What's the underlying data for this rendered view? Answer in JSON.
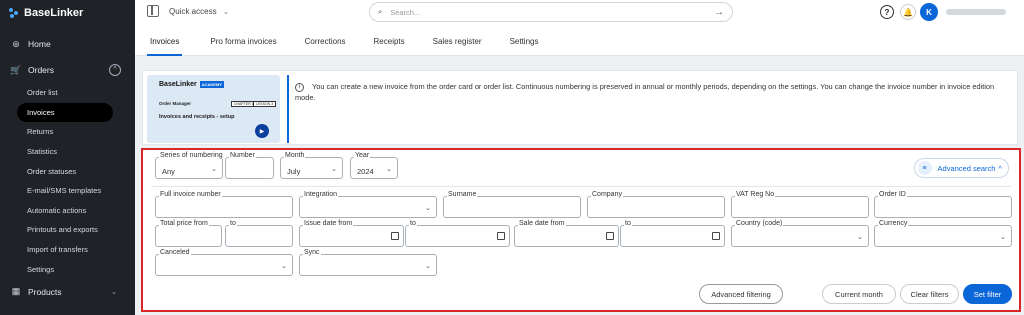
{
  "app": {
    "name": "BaseLinker"
  },
  "sidebar": {
    "home": "Home",
    "orders": "Orders",
    "order_items": [
      "Order list",
      "Invoices",
      "Returns",
      "Statistics",
      "Order statuses",
      "E-mail/SMS templates",
      "Automatic actions",
      "Printouts and exports",
      "Import of transfers",
      "Settings"
    ],
    "products": "Products"
  },
  "topbar": {
    "quick_access": "Quick access",
    "search_placeholder": "Search...",
    "avatar_letter": "K"
  },
  "tabs": [
    "Invoices",
    "Pro forma invoices",
    "Corrections",
    "Receipts",
    "Sales register",
    "Settings"
  ],
  "banner": {
    "thumb_brand": "BaseLinker",
    "thumb_badge": "ACADEMY",
    "thumb_subtitle": "Order Manager",
    "thumb_title": "Invoices and receipts - setup",
    "thumb_chapter": "CHAPTER 1",
    "thumb_lesson": "LESSON 3",
    "info": "You can create a new invoice from the order card or order list. Continuous numbering is preserved in annual or monthly periods, depending on the settings. You can change the invoice number in invoice edition mode."
  },
  "filters": {
    "series_label": "Series of numbering",
    "series_value": "Any",
    "number_label": "Number",
    "month_label": "Month",
    "month_value": "July",
    "year_label": "Year",
    "year_value": "2024",
    "advanced_search": "Advanced search",
    "full_invoice_number": "Full invoice number",
    "integration": "Integration",
    "surname": "Surname",
    "company": "Company",
    "vat": "VAT Reg No",
    "order_id": "Order ID",
    "total_from": "Total price from",
    "to": "to",
    "issue_from": "Issue date from",
    "sale_from": "Sale date from",
    "country": "Country (code)",
    "currency": "Currency",
    "canceled": "Canceled",
    "sync": "Sync",
    "btn_advanced_filtering": "Advanced filtering",
    "btn_current_month": "Current month",
    "btn_clear": "Clear filters",
    "btn_set": "Set filter"
  },
  "colors": {
    "accent": "#0b66d8",
    "highlight": "#d9262a",
    "sidebar": "#1f2227"
  }
}
